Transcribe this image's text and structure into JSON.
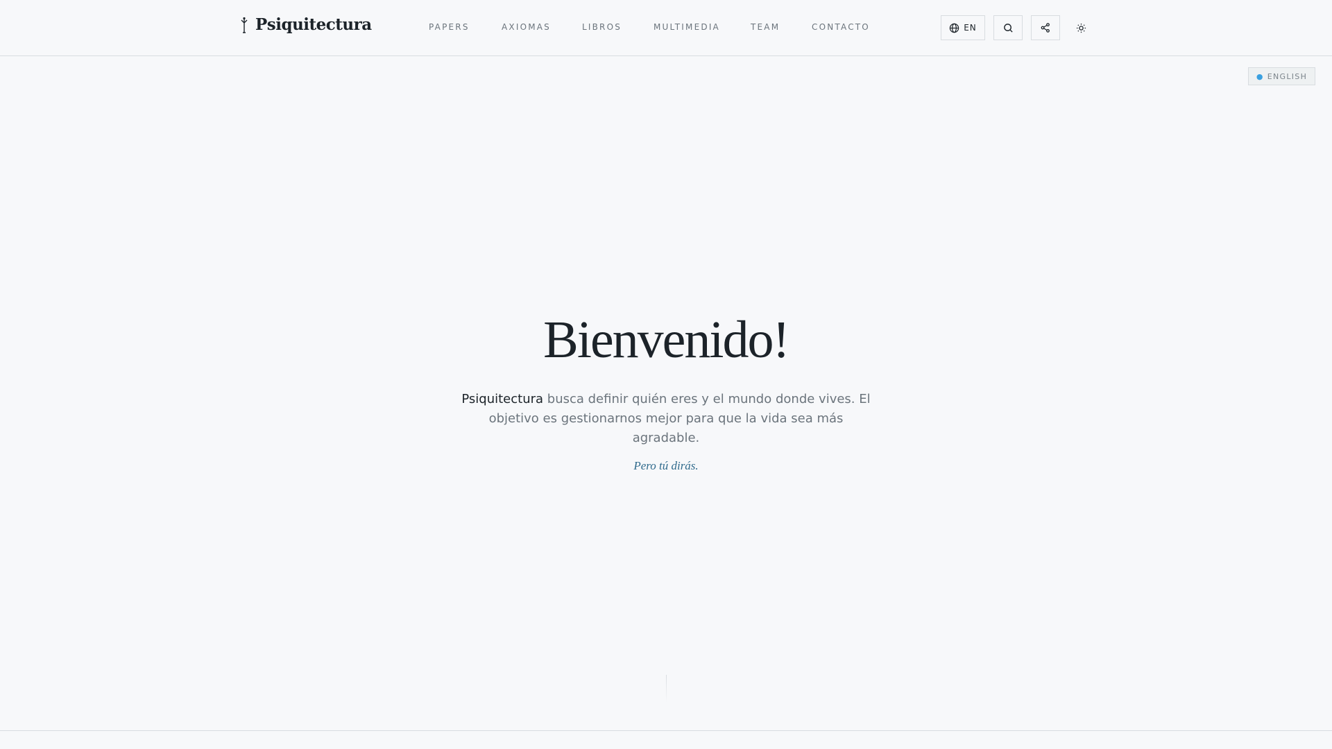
{
  "header": {
    "logo_title": "Psiquitectura",
    "nav": [
      "PAPERS",
      "AXIOMAS",
      "LIBROS",
      "MULTIMEDIA",
      "TEAM",
      "CONTACTO"
    ],
    "language_button": "EN"
  },
  "language_badge": "ENGLISH",
  "hero": {
    "title": "Bienvenido!",
    "brand": "Psiquitectura",
    "description": " busca definir quién eres y el mundo donde vives. El objetivo es gestionarnos mejor para que la vida sea más agradable.",
    "quote": "Pero tú dirás."
  },
  "colors": {
    "accent": "#2f6a8c",
    "background": "#f7f8fa",
    "border": "#d8dce0"
  }
}
